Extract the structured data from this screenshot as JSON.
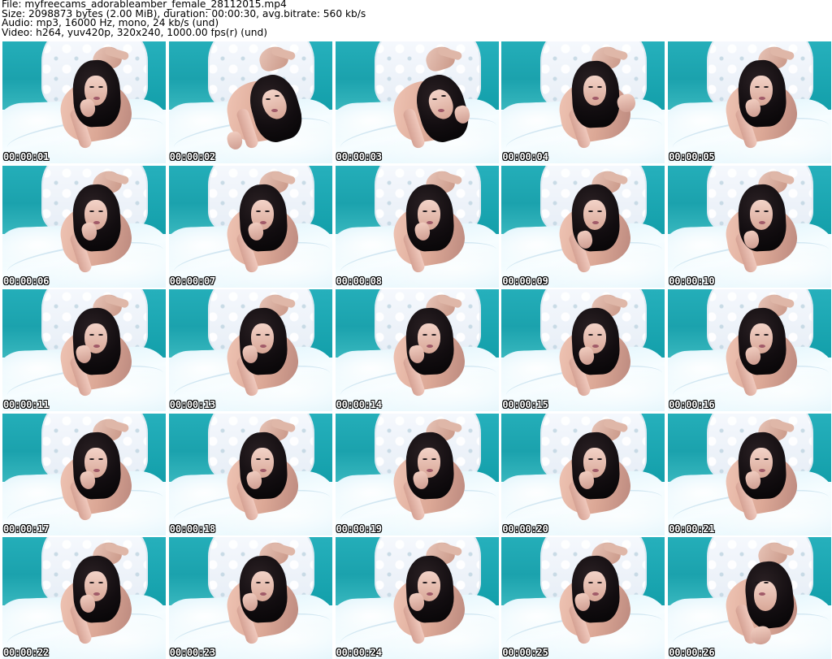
{
  "file_info": {
    "file": "File: myfreecams_adorableamber_female_28112015.mp4",
    "size": "Size: 2098873 bytes (2.00 MiB), duration: 00:00:30, avg.bitrate: 560 kb/s",
    "audio": "Audio: mp3, 16000 Hz, mono, 24 kb/s (und)",
    "video": "Video: h264, yuv420p, 320x240, 1000.00 fps(r) (und)"
  },
  "thumbnails": [
    {
      "timestamp": "00:00:01"
    },
    {
      "timestamp": "00:00:02"
    },
    {
      "timestamp": "00:00:03"
    },
    {
      "timestamp": "00:00:04"
    },
    {
      "timestamp": "00:00:05"
    },
    {
      "timestamp": "00:00:06"
    },
    {
      "timestamp": "00:00:07"
    },
    {
      "timestamp": "00:00:08"
    },
    {
      "timestamp": "00:00:09"
    },
    {
      "timestamp": "00:00:10"
    },
    {
      "timestamp": "00:00:11"
    },
    {
      "timestamp": "00:00:13"
    },
    {
      "timestamp": "00:00:14"
    },
    {
      "timestamp": "00:00:15"
    },
    {
      "timestamp": "00:00:16"
    },
    {
      "timestamp": "00:00:17"
    },
    {
      "timestamp": "00:00:18"
    },
    {
      "timestamp": "00:00:19"
    },
    {
      "timestamp": "00:00:20"
    },
    {
      "timestamp": "00:00:21"
    },
    {
      "timestamp": "00:00:22"
    },
    {
      "timestamp": "00:00:23"
    },
    {
      "timestamp": "00:00:24"
    },
    {
      "timestamp": "00:00:25"
    },
    {
      "timestamp": "00:00:26"
    }
  ],
  "colors": {
    "wall_teal": "#1ba2ad",
    "bedding_light_blue": "#e0f4fb",
    "timestamp_text": "#ffffff"
  }
}
